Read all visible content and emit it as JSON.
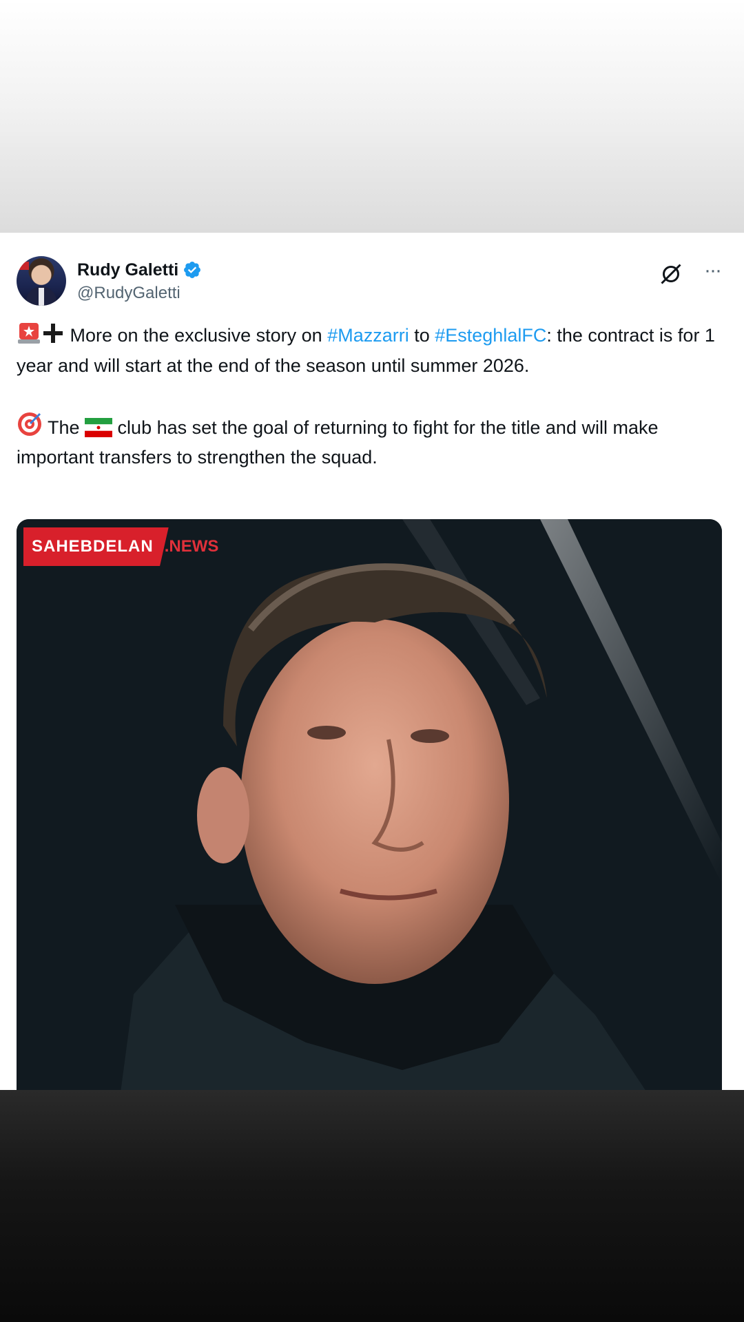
{
  "tweet": {
    "author": {
      "display_name": "Rudy Galetti",
      "handle": "@RudyGaletti",
      "verified": true
    },
    "icons": {
      "grok": "grok-icon",
      "more": "more-options-icon",
      "verified": "verified-badge-icon",
      "siren": "rotating-light-emoji",
      "plus": "heavy-plus-emoji",
      "target": "direct-hit-emoji",
      "flag": "iran-flag-emoji"
    },
    "paragraph1": {
      "part1": " More on the exclusive story on ",
      "hashtag1": "#Mazzarri",
      "part2": " to ",
      "hashtag2": "#EsteghlalFC",
      "part3": ": the contract is for 1 year and will start at the end of the season until summer 2026."
    },
    "paragraph2": {
      "part1": " The ",
      "part2": " club has set the goal of returning to fight for the title and will make important transfers to strengthen the squad."
    },
    "media": {
      "watermark_main": "SAHEBDELAN",
      "watermark_suffix": ".NEWS"
    }
  },
  "colors": {
    "hashtag": "#1d9bf0",
    "text": "#0f1419",
    "secondary": "#536471",
    "verified": "#1d9bf0",
    "watermark_red": "#d8202b"
  }
}
